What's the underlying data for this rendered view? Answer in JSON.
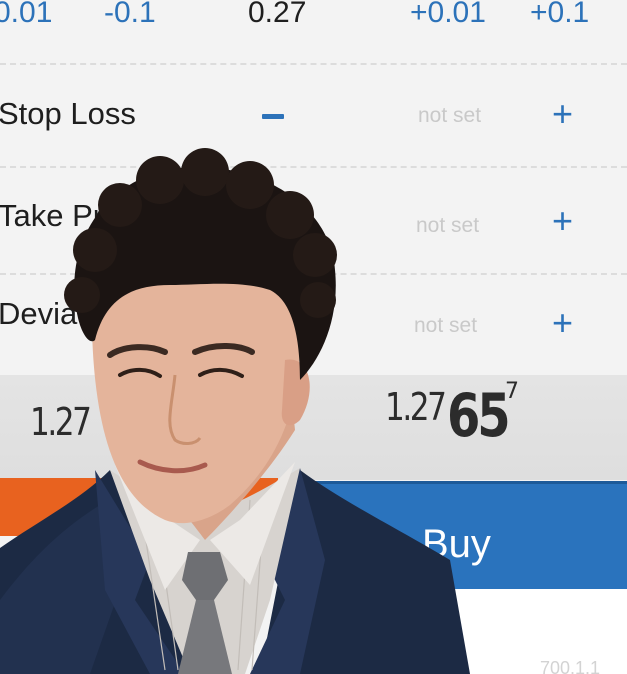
{
  "volume_row": {
    "steps_left": [
      "0.01",
      "-0.1"
    ],
    "value": "0.27",
    "steps_right": [
      "+0.01",
      "+0.1"
    ]
  },
  "fields": [
    {
      "label": "Stop Loss",
      "value": "not set"
    },
    {
      "label": "Take Pr",
      "value": "not set"
    },
    {
      "label": "Devia",
      "value": "not set"
    }
  ],
  "prices": {
    "bid_visible": "1.27",
    "ask_base": "1.27",
    "ask_big": "65",
    "ask_sup": "7"
  },
  "buttons": {
    "buy_label": "Buy"
  },
  "footer_faint": "700.1.1",
  "icons": {
    "minus": "minus-icon",
    "plus": "plus-icon"
  },
  "colors": {
    "accent_blue": "#2c72b9",
    "sell_orange": "#e8621f",
    "buy_blue": "#2a73bd"
  }
}
